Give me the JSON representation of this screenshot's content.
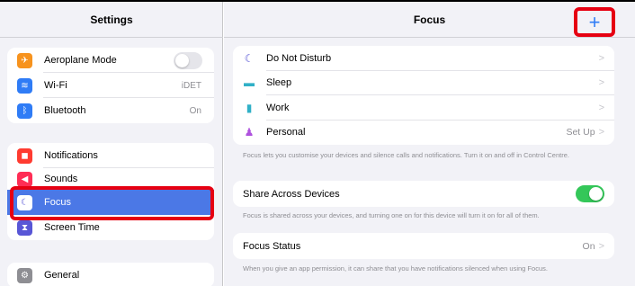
{
  "sidebar": {
    "title": "Settings",
    "group1": [
      {
        "label": "Aeroplane Mode",
        "icon": "airplane-icon",
        "color": "#f7931e",
        "glyph": "✈",
        "value": ""
      },
      {
        "label": "Wi-Fi",
        "icon": "wifi-icon",
        "color": "#2f7cf6",
        "glyph": "≋",
        "value": "iDET"
      },
      {
        "label": "Bluetooth",
        "icon": "bluetooth-icon",
        "color": "#2f7cf6",
        "glyph": "ᛒ",
        "value": "On"
      }
    ],
    "group2": [
      {
        "label": "Notifications",
        "icon": "notifications-icon",
        "color": "#ff3b30",
        "glyph": "◼"
      },
      {
        "label": "Sounds",
        "icon": "sounds-icon",
        "color": "#ff2d55",
        "glyph": "◀"
      },
      {
        "label": "Focus",
        "icon": "moon-icon",
        "color": "#5856d6",
        "glyph": "☾"
      },
      {
        "label": "Screen Time",
        "icon": "hourglass-icon",
        "color": "#5856d6",
        "glyph": "⧗"
      }
    ],
    "group3": [
      {
        "label": "General",
        "icon": "gear-icon",
        "color": "#8e8e93",
        "glyph": "⚙"
      }
    ]
  },
  "main": {
    "title": "Focus",
    "add_glyph": "+",
    "modes": [
      {
        "label": "Do Not Disturb",
        "icon": "moon-icon",
        "glyph": "☾",
        "color": "#5856d6",
        "value": ""
      },
      {
        "label": "Sleep",
        "icon": "bed-icon",
        "glyph": "▬",
        "color": "#30b0c7",
        "value": ""
      },
      {
        "label": "Work",
        "icon": "badge-icon",
        "glyph": "▮",
        "color": "#30b0c7",
        "value": ""
      },
      {
        "label": "Personal",
        "icon": "person-icon",
        "glyph": "♟",
        "color": "#af52de",
        "value": "Set Up"
      }
    ],
    "modes_note": "Focus lets you customise your devices and silence calls and notifications. Turn it on and off in Control Centre.",
    "share_label": "Share Across Devices",
    "share_note": "Focus is shared across your devices, and turning one on for this device will turn it on for all of them.",
    "status_label": "Focus Status",
    "status_value": "On",
    "status_note": "When you give an app permission, it can share that you have notifications silenced when using Focus.",
    "chevron": ">"
  }
}
